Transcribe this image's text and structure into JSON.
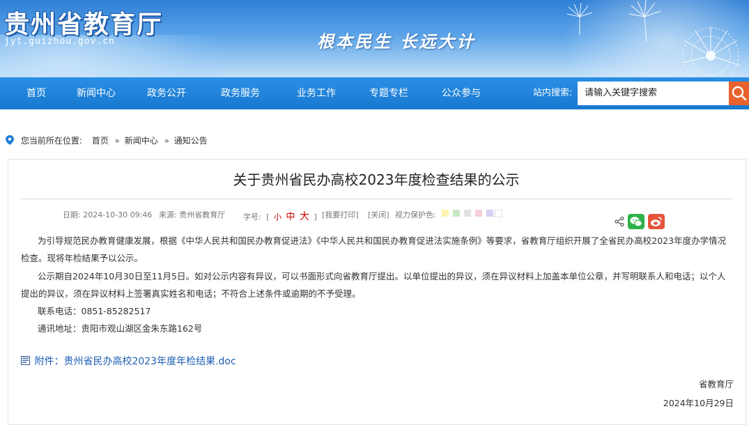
{
  "header": {
    "site_name": "贵州省教育厅",
    "site_domain": "jyt.guizhou.gov.cn",
    "slogan": "根本民生  长远大计"
  },
  "nav": {
    "items": [
      "首页",
      "新闻中心",
      "政务公开",
      "政务服务",
      "业务工作",
      "专题专栏",
      "公众参与"
    ],
    "search_label": "站内搜索:",
    "search_value": "请输入关键字搜索"
  },
  "breadcrumb": {
    "prefix": "您当前所在位置:",
    "items": [
      "首页",
      "新闻中心",
      "通知公告"
    ],
    "sep": "»"
  },
  "article": {
    "title": "关于贵州省民办高校2023年度检查结果的公示",
    "date_label": "日期:",
    "date": "2024-10-30 09:46",
    "source_label": "来源:",
    "source": "贵州省教育厅",
    "font_label": "字号:",
    "font_open": "[",
    "font_small": "小",
    "font_mid": "中",
    "font_large": "大",
    "font_close": "]",
    "print": "[我要打印]",
    "close": "[关闭]",
    "eye_label": "视力保护色:",
    "eye_colors": [
      "#fff3b0",
      "#c8e8c8",
      "#e2e2e2",
      "#f6cfd8",
      "#d8d0f2",
      "#ffffff"
    ],
    "paragraphs": [
      "为引导规范民办教育健康发展，根据《中华人民共和国民办教育促进法》《中华人民共和国民办教育促进法实施条例》等要求，省教育厅组织开展了全省民办高校2023年度办学情况检查。现将年检结果予以公示。",
      "公示期自2024年10月30日至11月5日。如对公示内容有异议，可以书面形式向省教育厅提出。以单位提出的异议，须在异议材料上加盖本单位公章，并写明联系人和电话；以个人提出的异议，须在异议材料上签署真实姓名和电话；不符合上述条件或逾期的不予受理。",
      "联系电话：0851-85282517",
      "通讯地址：贵阳市观山湖区金朱东路162号"
    ],
    "attachment": "附件：贵州省民办高校2023年度年检结果.doc",
    "signature": "省教育厅",
    "sign_date": "2024年10月29日"
  },
  "colors": {
    "nav": "#1878d0",
    "search_button": "#e8622d",
    "wechat": "#2fb24a",
    "weibo": "#e6543b",
    "link": "#1e5fb4"
  }
}
